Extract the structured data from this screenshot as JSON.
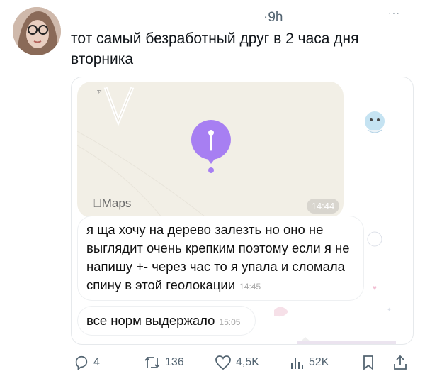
{
  "tweet": {
    "time": "·9h",
    "more": "···",
    "text": "тот самый безработный друг в 2 часа дня вторника"
  },
  "media": {
    "map": {
      "logo": "Maps",
      "timestamp": "14:44"
    },
    "messages": [
      {
        "text": "я ща хочу на дерево залезть но оно не выглядит очень крепким поэтому если я не напишу +- через час то я упала и сломала спину в этой геолокации",
        "time": "14:45"
      },
      {
        "text": "все норм выдержало",
        "time": "15:05"
      }
    ]
  },
  "actions": {
    "replies": "4",
    "retweets": "136",
    "likes": "4,5K",
    "views": "52K"
  },
  "colors": {
    "pin": "#a77ff2",
    "muted": "#536471",
    "map_bg": "#f2efe6"
  }
}
